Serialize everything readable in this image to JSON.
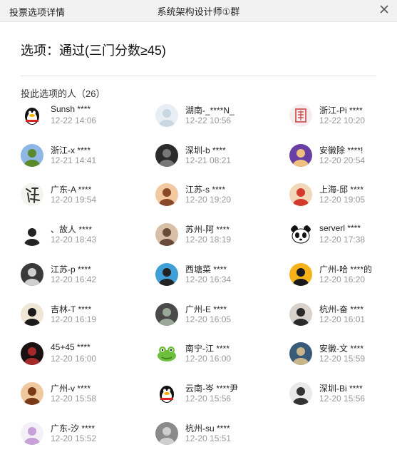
{
  "window": {
    "left_title": "投票选项详情",
    "center_title": "系统架构设计师①群"
  },
  "option": {
    "title": "选项：通过(三门分数≥45)"
  },
  "voters_label": "投此选项的人（26）",
  "voters": [
    {
      "name": "Sunsh ****",
      "time": "12-22 14:06",
      "avatar": "qq-penguin-icon"
    },
    {
      "name": "湖南-_****N_",
      "time": "12-22 10:56",
      "avatar": "cartoon-cat-avatar"
    },
    {
      "name": "浙江-Pi ****",
      "time": "12-22 10:20",
      "avatar": "seal-stamp-avatar"
    },
    {
      "name": "浙江-x ****",
      "time": "12-21 14:41",
      "avatar": "tree-landscape-avatar"
    },
    {
      "name": "深圳-b ****",
      "time": "12-21 08:21",
      "avatar": "dark-portrait-avatar"
    },
    {
      "name": "安徽除 ****!",
      "time": "12-20 20:54",
      "avatar": "glasses-cartoon-avatar"
    },
    {
      "name": "广东-A ****",
      "time": "12-20 19:54",
      "avatar": "calligraphy-avatar"
    },
    {
      "name": "江苏-s ****",
      "time": "12-20 19:20",
      "avatar": "cartoon-boy-avatar"
    },
    {
      "name": "上海-邱 ****",
      "time": "12-20 19:05",
      "avatar": "cartoon-face-avatar"
    },
    {
      "name": "、故人 ****",
      "time": "12-20 18:43",
      "avatar": "anime-girl-avatar"
    },
    {
      "name": "苏州-阿 ****",
      "time": "12-20 18:19",
      "avatar": "child-photo-avatar"
    },
    {
      "name": "serverl ****",
      "time": "12-20 17:38",
      "avatar": "panda-avatar"
    },
    {
      "name": "江苏-p ****",
      "time": "12-20 16:42",
      "avatar": "silhouette-avatar"
    },
    {
      "name": "西塘菜 ****",
      "time": "12-20 16:34",
      "avatar": "glasses-boy-avatar"
    },
    {
      "name": "广州-哈 ****的",
      "time": "12-20 16:20",
      "avatar": "sunset-tree-avatar"
    },
    {
      "name": "吉林-T ****",
      "time": "12-20 16:19",
      "avatar": "black-cat-avatar"
    },
    {
      "name": "广州-E ****",
      "time": "12-20 16:05",
      "avatar": "person-photo-avatar"
    },
    {
      "name": "杭州-奋 ****",
      "time": "12-20 16:01",
      "avatar": "couple-photo-avatar"
    },
    {
      "name": "45+45 ****",
      "time": "12-20 16:00",
      "avatar": "red-dark-avatar"
    },
    {
      "name": "南宁-江 ****",
      "time": "12-20 16:00",
      "avatar": "green-frog-avatar"
    },
    {
      "name": "安徽-文 ****",
      "time": "12-20 15:59",
      "avatar": "landscape-avatar"
    },
    {
      "name": "广州-v ****",
      "time": "12-20 15:58",
      "avatar": "anime-boy-avatar"
    },
    {
      "name": "云南-岑 ****尹",
      "time": "12-20 15:56",
      "avatar": "qq-penguin-icon"
    },
    {
      "name": "深圳-Bi ****",
      "time": "12-20 15:56",
      "avatar": "gray-sky-avatar"
    },
    {
      "name": "广东-汐 ****",
      "time": "12-20 15:52",
      "avatar": "girl-drawing-avatar"
    },
    {
      "name": "杭州-su ****",
      "time": "12-20 15:51",
      "avatar": "gray-cat-avatar"
    }
  ]
}
